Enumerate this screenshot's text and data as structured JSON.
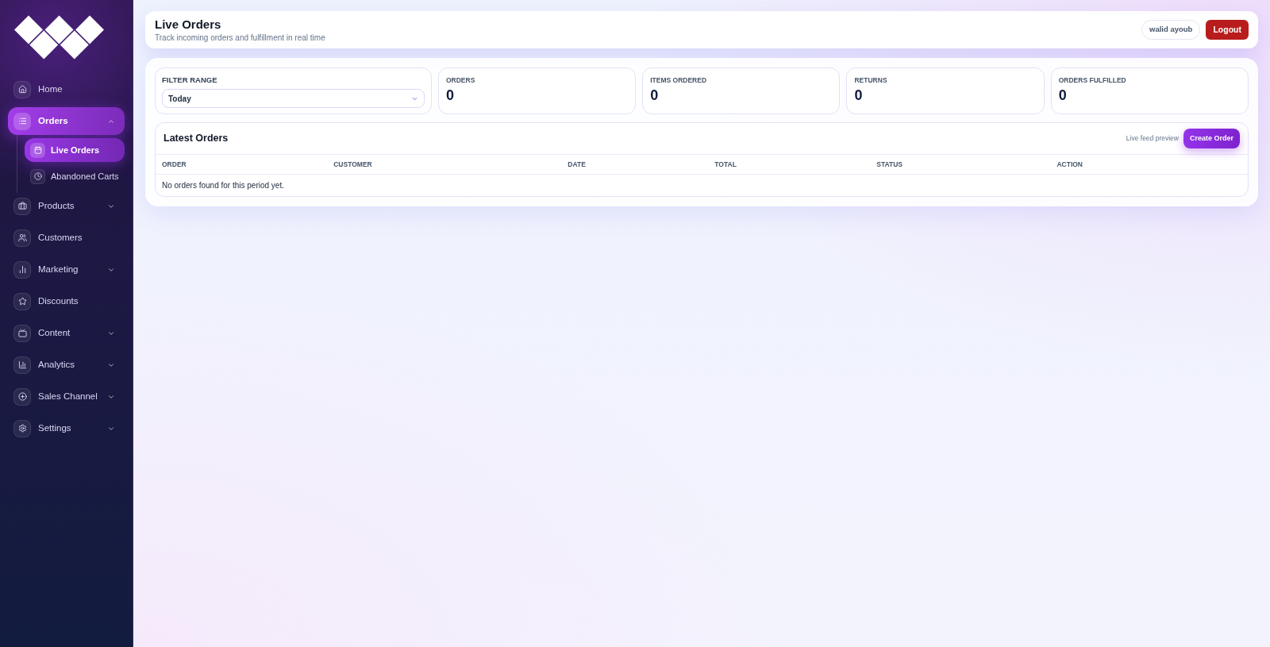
{
  "sidebar": {
    "items": [
      {
        "label": "Home",
        "kind": "link",
        "selected": false
      },
      {
        "label": "Orders",
        "kind": "group",
        "selected": true,
        "expanded": true,
        "children": [
          {
            "label": "Live Orders",
            "selected": true
          },
          {
            "label": "Abandoned Carts",
            "selected": false
          }
        ]
      },
      {
        "label": "Products",
        "kind": "group",
        "selected": false,
        "expanded": false
      },
      {
        "label": "Customers",
        "kind": "link",
        "selected": false
      },
      {
        "label": "Marketing",
        "kind": "group",
        "selected": false,
        "expanded": false
      },
      {
        "label": "Discounts",
        "kind": "link",
        "selected": false
      },
      {
        "label": "Content",
        "kind": "group",
        "selected": false,
        "expanded": false
      },
      {
        "label": "Analytics",
        "kind": "group",
        "selected": false,
        "expanded": false
      },
      {
        "label": "Sales Channel",
        "kind": "group",
        "selected": false,
        "expanded": false
      },
      {
        "label": "Settings",
        "kind": "group",
        "selected": false,
        "expanded": false
      }
    ]
  },
  "header": {
    "title": "Live Orders",
    "subtitle": "Track incoming orders and fulfillment in real time",
    "user": "walid ayoub",
    "logout_button": "Logout"
  },
  "filter": {
    "label": "FILTER RANGE",
    "value": "Today"
  },
  "stats": [
    {
      "label": "ORDERS",
      "value": "0"
    },
    {
      "label": "ITEMS ORDERED",
      "value": "0"
    },
    {
      "label": "RETURNS",
      "value": "0"
    },
    {
      "label": "ORDERS FULFILLED",
      "value": "0"
    }
  ],
  "latest_orders": {
    "title": "Latest Orders",
    "note": "Live feed preview",
    "create_button": "Create Order",
    "columns": [
      "ORDER",
      "CUSTOMER",
      "DATE",
      "TOTAL",
      "STATUS",
      "ACTION"
    ],
    "empty_message": "No orders found for this period yet."
  }
}
